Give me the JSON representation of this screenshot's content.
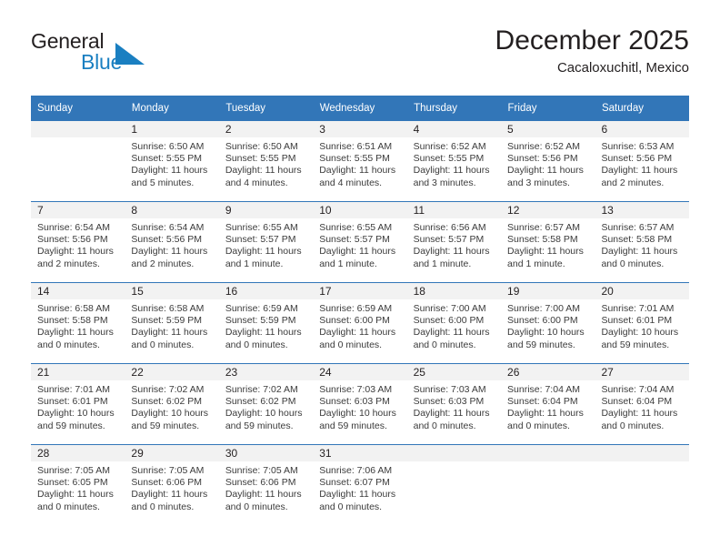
{
  "brand": {
    "name_part1": "General",
    "name_part2": "Blue",
    "flag_color": "#1a7fc1",
    "text_color": "#231f20"
  },
  "header": {
    "title": "December 2025",
    "subtitle": "Cacaloxuchitl, Mexico"
  },
  "theme": {
    "header_blue": "#3276b8",
    "daynum_band": "#f2f2f2",
    "body_text": "#3b3b3b"
  },
  "weekday_headers": [
    "Sunday",
    "Monday",
    "Tuesday",
    "Wednesday",
    "Thursday",
    "Friday",
    "Saturday"
  ],
  "weeks": [
    [
      {
        "day": "",
        "sunrise": "",
        "sunset": "",
        "daylight_line1": "",
        "daylight_line2": ""
      },
      {
        "day": "1",
        "sunrise": "Sunrise: 6:50 AM",
        "sunset": "Sunset: 5:55 PM",
        "daylight_line1": "Daylight: 11 hours",
        "daylight_line2": "and 5 minutes."
      },
      {
        "day": "2",
        "sunrise": "Sunrise: 6:50 AM",
        "sunset": "Sunset: 5:55 PM",
        "daylight_line1": "Daylight: 11 hours",
        "daylight_line2": "and 4 minutes."
      },
      {
        "day": "3",
        "sunrise": "Sunrise: 6:51 AM",
        "sunset": "Sunset: 5:55 PM",
        "daylight_line1": "Daylight: 11 hours",
        "daylight_line2": "and 4 minutes."
      },
      {
        "day": "4",
        "sunrise": "Sunrise: 6:52 AM",
        "sunset": "Sunset: 5:55 PM",
        "daylight_line1": "Daylight: 11 hours",
        "daylight_line2": "and 3 minutes."
      },
      {
        "day": "5",
        "sunrise": "Sunrise: 6:52 AM",
        "sunset": "Sunset: 5:56 PM",
        "daylight_line1": "Daylight: 11 hours",
        "daylight_line2": "and 3 minutes."
      },
      {
        "day": "6",
        "sunrise": "Sunrise: 6:53 AM",
        "sunset": "Sunset: 5:56 PM",
        "daylight_line1": "Daylight: 11 hours",
        "daylight_line2": "and 2 minutes."
      }
    ],
    [
      {
        "day": "7",
        "sunrise": "Sunrise: 6:54 AM",
        "sunset": "Sunset: 5:56 PM",
        "daylight_line1": "Daylight: 11 hours",
        "daylight_line2": "and 2 minutes."
      },
      {
        "day": "8",
        "sunrise": "Sunrise: 6:54 AM",
        "sunset": "Sunset: 5:56 PM",
        "daylight_line1": "Daylight: 11 hours",
        "daylight_line2": "and 2 minutes."
      },
      {
        "day": "9",
        "sunrise": "Sunrise: 6:55 AM",
        "sunset": "Sunset: 5:57 PM",
        "daylight_line1": "Daylight: 11 hours",
        "daylight_line2": "and 1 minute."
      },
      {
        "day": "10",
        "sunrise": "Sunrise: 6:55 AM",
        "sunset": "Sunset: 5:57 PM",
        "daylight_line1": "Daylight: 11 hours",
        "daylight_line2": "and 1 minute."
      },
      {
        "day": "11",
        "sunrise": "Sunrise: 6:56 AM",
        "sunset": "Sunset: 5:57 PM",
        "daylight_line1": "Daylight: 11 hours",
        "daylight_line2": "and 1 minute."
      },
      {
        "day": "12",
        "sunrise": "Sunrise: 6:57 AM",
        "sunset": "Sunset: 5:58 PM",
        "daylight_line1": "Daylight: 11 hours",
        "daylight_line2": "and 1 minute."
      },
      {
        "day": "13",
        "sunrise": "Sunrise: 6:57 AM",
        "sunset": "Sunset: 5:58 PM",
        "daylight_line1": "Daylight: 11 hours",
        "daylight_line2": "and 0 minutes."
      }
    ],
    [
      {
        "day": "14",
        "sunrise": "Sunrise: 6:58 AM",
        "sunset": "Sunset: 5:58 PM",
        "daylight_line1": "Daylight: 11 hours",
        "daylight_line2": "and 0 minutes."
      },
      {
        "day": "15",
        "sunrise": "Sunrise: 6:58 AM",
        "sunset": "Sunset: 5:59 PM",
        "daylight_line1": "Daylight: 11 hours",
        "daylight_line2": "and 0 minutes."
      },
      {
        "day": "16",
        "sunrise": "Sunrise: 6:59 AM",
        "sunset": "Sunset: 5:59 PM",
        "daylight_line1": "Daylight: 11 hours",
        "daylight_line2": "and 0 minutes."
      },
      {
        "day": "17",
        "sunrise": "Sunrise: 6:59 AM",
        "sunset": "Sunset: 6:00 PM",
        "daylight_line1": "Daylight: 11 hours",
        "daylight_line2": "and 0 minutes."
      },
      {
        "day": "18",
        "sunrise": "Sunrise: 7:00 AM",
        "sunset": "Sunset: 6:00 PM",
        "daylight_line1": "Daylight: 11 hours",
        "daylight_line2": "and 0 minutes."
      },
      {
        "day": "19",
        "sunrise": "Sunrise: 7:00 AM",
        "sunset": "Sunset: 6:00 PM",
        "daylight_line1": "Daylight: 10 hours",
        "daylight_line2": "and 59 minutes."
      },
      {
        "day": "20",
        "sunrise": "Sunrise: 7:01 AM",
        "sunset": "Sunset: 6:01 PM",
        "daylight_line1": "Daylight: 10 hours",
        "daylight_line2": "and 59 minutes."
      }
    ],
    [
      {
        "day": "21",
        "sunrise": "Sunrise: 7:01 AM",
        "sunset": "Sunset: 6:01 PM",
        "daylight_line1": "Daylight: 10 hours",
        "daylight_line2": "and 59 minutes."
      },
      {
        "day": "22",
        "sunrise": "Sunrise: 7:02 AM",
        "sunset": "Sunset: 6:02 PM",
        "daylight_line1": "Daylight: 10 hours",
        "daylight_line2": "and 59 minutes."
      },
      {
        "day": "23",
        "sunrise": "Sunrise: 7:02 AM",
        "sunset": "Sunset: 6:02 PM",
        "daylight_line1": "Daylight: 10 hours",
        "daylight_line2": "and 59 minutes."
      },
      {
        "day": "24",
        "sunrise": "Sunrise: 7:03 AM",
        "sunset": "Sunset: 6:03 PM",
        "daylight_line1": "Daylight: 10 hours",
        "daylight_line2": "and 59 minutes."
      },
      {
        "day": "25",
        "sunrise": "Sunrise: 7:03 AM",
        "sunset": "Sunset: 6:03 PM",
        "daylight_line1": "Daylight: 11 hours",
        "daylight_line2": "and 0 minutes."
      },
      {
        "day": "26",
        "sunrise": "Sunrise: 7:04 AM",
        "sunset": "Sunset: 6:04 PM",
        "daylight_line1": "Daylight: 11 hours",
        "daylight_line2": "and 0 minutes."
      },
      {
        "day": "27",
        "sunrise": "Sunrise: 7:04 AM",
        "sunset": "Sunset: 6:04 PM",
        "daylight_line1": "Daylight: 11 hours",
        "daylight_line2": "and 0 minutes."
      }
    ],
    [
      {
        "day": "28",
        "sunrise": "Sunrise: 7:05 AM",
        "sunset": "Sunset: 6:05 PM",
        "daylight_line1": "Daylight: 11 hours",
        "daylight_line2": "and 0 minutes."
      },
      {
        "day": "29",
        "sunrise": "Sunrise: 7:05 AM",
        "sunset": "Sunset: 6:06 PM",
        "daylight_line1": "Daylight: 11 hours",
        "daylight_line2": "and 0 minutes."
      },
      {
        "day": "30",
        "sunrise": "Sunrise: 7:05 AM",
        "sunset": "Sunset: 6:06 PM",
        "daylight_line1": "Daylight: 11 hours",
        "daylight_line2": "and 0 minutes."
      },
      {
        "day": "31",
        "sunrise": "Sunrise: 7:06 AM",
        "sunset": "Sunset: 6:07 PM",
        "daylight_line1": "Daylight: 11 hours",
        "daylight_line2": "and 0 minutes."
      },
      {
        "day": "",
        "sunrise": "",
        "sunset": "",
        "daylight_line1": "",
        "daylight_line2": ""
      },
      {
        "day": "",
        "sunrise": "",
        "sunset": "",
        "daylight_line1": "",
        "daylight_line2": ""
      },
      {
        "day": "",
        "sunrise": "",
        "sunset": "",
        "daylight_line1": "",
        "daylight_line2": ""
      }
    ]
  ]
}
